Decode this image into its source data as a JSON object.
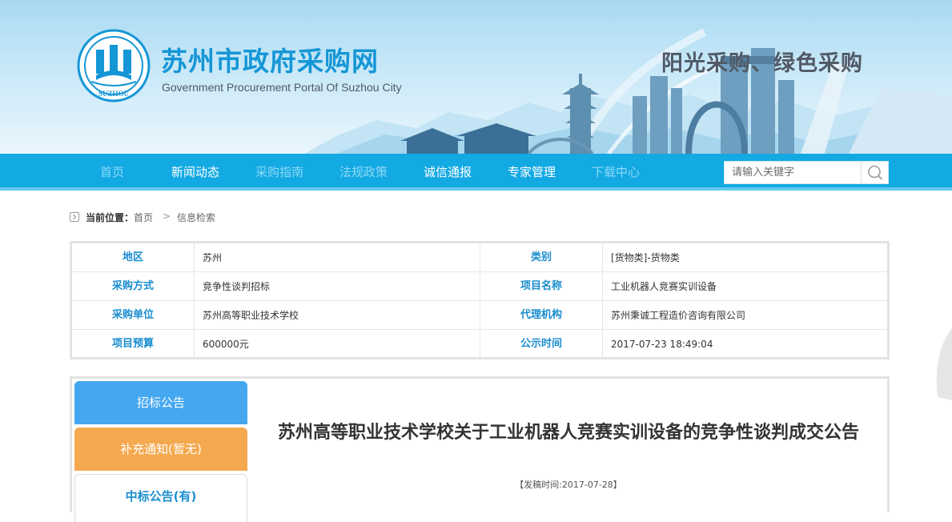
{
  "header": {
    "site_title": "苏州市政府采购网",
    "site_subtitle": "Government Procurement Portal Of Suzhou City",
    "slogan": "阳光采购、绿色采购",
    "logo_text": "SUZHOU",
    "colors": {
      "title": "#1596d6",
      "nav": "#13a9e3",
      "slogan": "#515a66"
    }
  },
  "nav": {
    "items": [
      {
        "label": "首页",
        "dim": true
      },
      {
        "label": "新闻动态",
        "dim": false
      },
      {
        "label": "采购指南",
        "dim": true
      },
      {
        "label": "法规政策",
        "dim": true
      },
      {
        "label": "诚信通报",
        "dim": false
      },
      {
        "label": "专家管理",
        "dim": false
      },
      {
        "label": "下载中心",
        "dim": true
      }
    ],
    "search": {
      "placeholder": "请输入关键字",
      "icon": "search-icon"
    }
  },
  "breadcrumb": {
    "current_label": "当前位置：",
    "home": "首页",
    "separator": ">",
    "page": "信息检索"
  },
  "info": {
    "rows": [
      {
        "label1": "地区",
        "value1": "苏州",
        "label2": "类别",
        "value2": "[货物类]-货物类"
      },
      {
        "label1": "采购方式",
        "value1": "竞争性谈判招标",
        "label2": "项目名称",
        "value2": "工业机器人竞赛实训设备"
      },
      {
        "label1": "采购单位",
        "value1": "苏州高等职业技术学校",
        "label2": "代理机构",
        "value2": "苏州秉诚工程造价咨询有限公司"
      },
      {
        "label1": "项目预算",
        "value1": "600000元",
        "label2": "公示时间",
        "value2": "2017-07-23 18:49:04"
      }
    ]
  },
  "tabs": [
    {
      "label": "招标公告",
      "color": "#45a7f0"
    },
    {
      "label": "补充通知(暂无)",
      "color": "#f5a94f"
    },
    {
      "label": "中标公告(有)",
      "color": "#1a8dcf"
    }
  ],
  "article": {
    "title": "苏州高等职业技术学校关于工业机器人竞赛实训设备的竞争性谈判成交公告",
    "date": "【发稿时间:2017-07-28】"
  }
}
